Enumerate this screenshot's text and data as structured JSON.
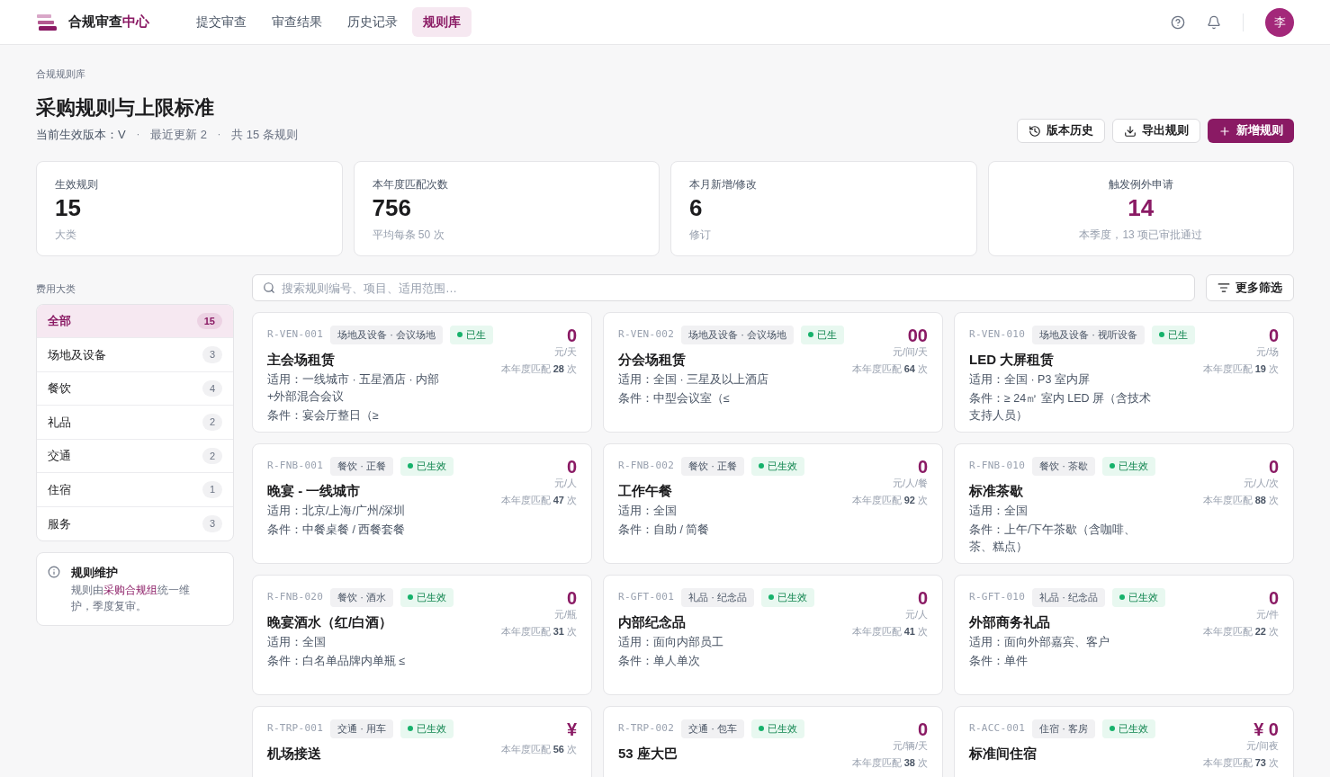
{
  "brand": {
    "text": "合规审查",
    "accent": "中心"
  },
  "nav": [
    {
      "label": "提交审查",
      "selected": false
    },
    {
      "label": "审查结果",
      "selected": false
    },
    {
      "label": "历史记录",
      "selected": false
    },
    {
      "label": "规则库",
      "selected": true
    }
  ],
  "avatar": "李",
  "breadcrumb": "合规规则库",
  "title": "采购规则与上限标准",
  "meta": [
    "当前生效版本：V",
    "最近更新 2",
    "共 15 条规则"
  ],
  "meta_separator": "·",
  "actions": [
    {
      "label": "版本历史",
      "kind": "history"
    },
    {
      "label": "导出规则",
      "kind": "export"
    },
    {
      "label": "新增规则",
      "kind": "add"
    }
  ],
  "stats": [
    {
      "label": "生效规则",
      "value": "15",
      "note": "大类",
      "kind": "plain"
    },
    {
      "label": "本年度匹配次数",
      "value": "756",
      "note": "平均每条 50 次",
      "kind": "plain"
    },
    {
      "label": "本月新增/修改",
      "value": "6",
      "note": "修订",
      "kind": "plain"
    },
    {
      "label": "触发例外申请",
      "value": "14",
      "note": "本季度，13 项已审批通过",
      "kind": "accent"
    }
  ],
  "sidebar": {
    "heading": "费用大类",
    "items": [
      {
        "label": "全部",
        "count": "15",
        "selected": true
      },
      {
        "label": "场地及设备",
        "count": "3",
        "selected": false
      },
      {
        "label": "餐饮",
        "count": "4",
        "selected": false
      },
      {
        "label": "礼品",
        "count": "2",
        "selected": false
      },
      {
        "label": "交通",
        "count": "2",
        "selected": false
      },
      {
        "label": "住宿",
        "count": "1",
        "selected": false
      },
      {
        "label": "服务",
        "count": "3",
        "selected": false
      }
    ],
    "note": {
      "title": "规则维护",
      "text_before": "规则由",
      "link": "采购合规组",
      "text_after": "统一维护，季度复审。"
    }
  },
  "search": {
    "placeholder": "搜索规则编号、项目、适用范围…"
  },
  "filter_button": "更多筛选",
  "rules": [
    {
      "code": "R-VEN-001",
      "tag": "场地及设备 · 会议场地",
      "status": "已生",
      "price": "0",
      "unit": "元/天",
      "matches": [
        "本年度匹配",
        "28",
        "次"
      ],
      "name": "主会场租赁",
      "lines": [
        "适用：一线城市 · 五星酒店 · 内部+外部混合会议",
        "条件：宴会厅整日（≥"
      ]
    },
    {
      "code": "R-VEN-002",
      "tag": "场地及设备 · 会议场地",
      "status": "已生",
      "price": "00",
      "unit": "元/间/天",
      "matches": [
        "本年度匹配",
        "64",
        "次"
      ],
      "name": "分会场租赁",
      "lines": [
        "适用：全国 · 三星及以上酒店",
        "条件：中型会议室（≤"
      ]
    },
    {
      "code": "R-VEN-010",
      "tag": "场地及设备 · 视听设备",
      "status": "已生",
      "price": "0",
      "unit": "元/场",
      "matches": [
        "本年度匹配",
        "19",
        "次"
      ],
      "name": "LED 大屏租赁",
      "lines": [
        "适用：全国 · P3 室内屏",
        "条件：≥ 24㎡ 室内 LED 屏（含技术支持人员）"
      ]
    },
    {
      "code": "R-FNB-001",
      "tag": "餐饮 · 正餐",
      "status": "已生效",
      "price": "0",
      "unit": "元/人",
      "matches": [
        "本年度匹配",
        "47",
        "次"
      ],
      "name": "晚宴 - 一线城市",
      "lines": [
        "适用：北京/上海/广州/深圳",
        "条件：中餐桌餐 / 西餐套餐"
      ]
    },
    {
      "code": "R-FNB-002",
      "tag": "餐饮 · 正餐",
      "status": "已生效",
      "price": "0",
      "unit": "元/人/餐",
      "matches": [
        "本年度匹配",
        "92",
        "次"
      ],
      "name": "工作午餐",
      "lines": [
        "适用：全国",
        "条件：自助 / 简餐"
      ]
    },
    {
      "code": "R-FNB-010",
      "tag": "餐饮 · 茶歇",
      "status": "已生效",
      "price": "0",
      "unit": "元/人/次",
      "matches": [
        "本年度匹配",
        "88",
        "次"
      ],
      "name": "标准茶歇",
      "lines": [
        "适用：全国",
        "条件：上午/下午茶歇（含咖啡、茶、糕点）"
      ]
    },
    {
      "code": "R-FNB-020",
      "tag": "餐饮 · 酒水",
      "status": "已生效",
      "price": "0",
      "unit": "元/瓶",
      "matches": [
        "本年度匹配",
        "31",
        "次"
      ],
      "name": "晚宴酒水（红/白酒）",
      "lines": [
        "适用：全国",
        "条件：白名单品牌内单瓶 ≤"
      ]
    },
    {
      "code": "R-GFT-001",
      "tag": "礼品 · 纪念品",
      "status": "已生效",
      "price": "0",
      "unit": "元/人",
      "matches": [
        "本年度匹配",
        "41",
        "次"
      ],
      "name": "内部纪念品",
      "lines": [
        "适用：面向内部员工",
        "条件：单人单次"
      ]
    },
    {
      "code": "R-GFT-010",
      "tag": "礼品 · 纪念品",
      "status": "已生效",
      "price": "0",
      "unit": "元/件",
      "matches": [
        "本年度匹配",
        "22",
        "次"
      ],
      "name": "外部商务礼品",
      "lines": [
        "适用：面向外部嘉宾、客户",
        "条件：单件"
      ]
    },
    {
      "code": "R-TRP-001",
      "tag": "交通 · 用车",
      "status": "已生效",
      "price": "¥",
      "matches": [
        "本年度匹配",
        "56",
        "次"
      ],
      "name": "机场接送"
    },
    {
      "code": "R-TRP-002",
      "tag": "交通 · 包车",
      "status": "已生效",
      "price": "0",
      "unit": "元/辆/天",
      "matches": [
        "本年度匹配",
        "38",
        "次"
      ],
      "name": "53 座大巴"
    },
    {
      "code": "R-ACC-001",
      "tag": "住宿 · 客房",
      "status": "已生效",
      "price": "¥ 0",
      "unit": "元/间夜",
      "matches": [
        "本年度匹配",
        "73",
        "次"
      ],
      "name": "标准间住宿"
    }
  ]
}
